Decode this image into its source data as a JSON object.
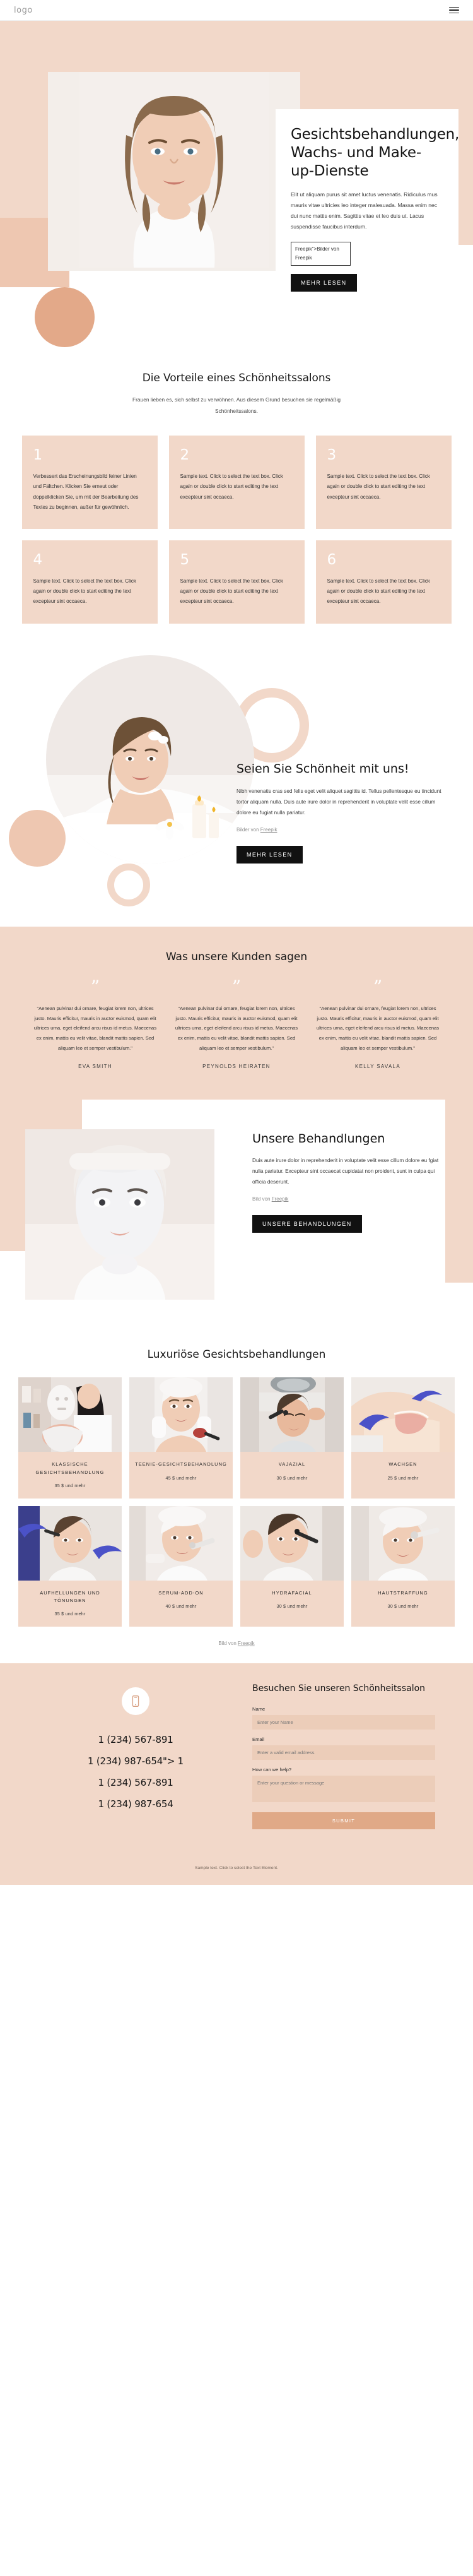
{
  "header": {
    "logo": "logo",
    "menu_icon": "hamburger-icon"
  },
  "hero": {
    "title": "Gesichtsbehandlungen, Wachs- und Make-up-Dienste",
    "body": "Elit ut aliquam purus sit amet luctus venenatis. Ridiculus mus mauris vitae ultricies leo integer malesuada. Massa enim nec dui nunc mattis enim. Sagittis vitae et leo duis ut. Lacus suspendisse faucibus interdum.",
    "credit": "Freepik\">Bilder von Freepik",
    "cta": "MEHR LESEN"
  },
  "benefits": {
    "title": "Die Vorteile eines Schönheitssalons",
    "subtitle": "Frauen lieben es, sich selbst zu verwöhnen. Aus diesem Grund besuchen sie regelmäßig Schönheitssalons.",
    "cards": [
      {
        "num": "1",
        "text": "Verbessert das Erscheinungsbild feiner Linien und Fältchen. Klicken Sie erneut oder doppelklicken Sie, um mit der Bearbeitung des Textes zu beginnen, außer für gewöhnlich."
      },
      {
        "num": "2",
        "text": "Sample text. Click to select the text box. Click again or double click to start editing the text excepteur sint occaeca."
      },
      {
        "num": "3",
        "text": "Sample text. Click to select the text box. Click again or double click to start editing the text excepteur sint occaeca."
      },
      {
        "num": "4",
        "text": "Sample text. Click to select the text box. Click again or double click to start editing the text excepteur sint occaeca."
      },
      {
        "num": "5",
        "text": "Sample text. Click to select the text box. Click again or double click to start editing the text excepteur sint occaeca."
      },
      {
        "num": "6",
        "text": "Sample text. Click to select the text box. Click again or double click to start editing the text excepteur sint occaeca."
      }
    ]
  },
  "beauty": {
    "title": "Seien Sie Schönheit mit uns!",
    "body": "Nibh venenatis cras sed felis eget velit aliquet sagittis id. Tellus pellentesque eu tincidunt tortor aliquam nulla. Duis aute irure dolor in reprehenderit in voluptate velit esse cillum dolore eu fugiat nulla pariatur.",
    "credit_prefix": "Bilder von ",
    "credit_link": "Freepik",
    "cta": "MEHR LESEN"
  },
  "testimonials": {
    "title": "Was unsere Kunden sagen",
    "quote_glyph": "”",
    "items": [
      {
        "text": "\"Aenean pulvinar dui ornare, feugiat lorem non, ultrices justo. Mauris efficitur, mauris in auctor euismod, quam elit ultrices urna, eget eleifend arcu risus id metus. Maecenas ex enim, mattis eu velit vitae, blandit mattis sapien. Sed aliquam leo et semper vestibulum.\"",
        "name": "EVA SMITH"
      },
      {
        "text": "\"Aenean pulvinar dui ornare, feugiat lorem non, ultrices justo. Mauris efficitur, mauris in auctor euismod, quam elit ultrices urna, eget eleifend arcu risus id metus. Maecenas ex enim, mattis eu velit vitae, blandit mattis sapien. Sed aliquam leo et semper vestibulum.\"",
        "name": "PEYNOLDS HEIRATEN"
      },
      {
        "text": "\"Aenean pulvinar dui ornare, feugiat lorem non, ultrices justo. Mauris efficitur, mauris in auctor euismod, quam elit ultrices urna, eget eleifend arcu risus id metus. Maecenas ex enim, mattis eu velit vitae, blandit mattis sapien. Sed aliquam leo et semper vestibulum.\"",
        "name": "KELLY SAVALA"
      }
    ]
  },
  "treatments": {
    "title": "Unsere Behandlungen",
    "body": "Duis aute irure dolor in reprehenderit in voluptate velit esse cillum dolore eu fgiat nulla pariatur. Excepteur sint occaecat cupidatat non proident, sunt in culpa qui officia deserunt.",
    "credit_prefix": "Bild von ",
    "credit_link": "Freepik",
    "cta": "UNSERE BEHANDLUNGEN"
  },
  "luxury": {
    "title": "Luxuriöse Gesichtsbehandlungen",
    "credit_prefix": "Bild von ",
    "credit_link": "Freepik",
    "cards": [
      {
        "title": "KLASSISCHE GESICHTSBEHANDLUNG",
        "price": "35 $ und mehr"
      },
      {
        "title": "TEENIE-GESICHTSBEHANDLUNG",
        "price": "45 $ und mehr"
      },
      {
        "title": "VAJAZIAL",
        "price": "30 $ und mehr"
      },
      {
        "title": "WACHSEN",
        "price": "25 $ und mehr"
      },
      {
        "title": "AUFHELLUNGEN UND TÖNUNGEN",
        "price": "35 $ und mehr"
      },
      {
        "title": "SERUM-ADD-ON",
        "price": "40 $ und mehr"
      },
      {
        "title": "HYDRAFACIAL",
        "price": "30 $ und mehr"
      },
      {
        "title": "HAUTSTRAFFUNG",
        "price": "30 $ und mehr"
      }
    ]
  },
  "contact": {
    "icon": "phone-icon",
    "phones": [
      "1 (234) 567-891",
      "1 (234) 987-654\"> 1",
      "1 (234) 567-891",
      "1 (234) 987-654"
    ],
    "form_title": "Besuchen Sie unseren Schönheitssalon",
    "fields": [
      {
        "label": "Name",
        "placeholder": "Enter your Name",
        "value": ""
      },
      {
        "label": "Email",
        "placeholder": "Enter a valid email address",
        "value": ""
      },
      {
        "label": "How can we help?",
        "placeholder": "Enter your question or message",
        "value": ""
      }
    ],
    "submit": "SUBMIT"
  },
  "footer": {
    "text": "Sample text. Click to select the Text Element."
  }
}
